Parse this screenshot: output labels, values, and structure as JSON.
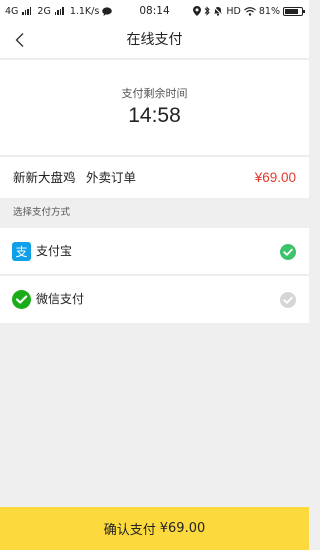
{
  "status_bar": {
    "net1": "4G",
    "net2": "2G",
    "speed": "1.1K/s",
    "time": "08:14",
    "hd": "HD",
    "battery": "81%",
    "battery_level": 0.81
  },
  "header": {
    "title": "在线支付"
  },
  "timer": {
    "label": "支付剩余时间",
    "value": "14:58"
  },
  "order": {
    "shop": "新新大盘鸡",
    "type": "外卖订单",
    "price": "¥69.00"
  },
  "payment": {
    "section_title": "选择支付方式",
    "options": [
      {
        "label": "支付宝",
        "icon": "alipay-icon",
        "selected": true
      },
      {
        "label": "微信支付",
        "icon": "wechat-icon",
        "selected": false
      }
    ]
  },
  "confirm": {
    "label": "确认支付",
    "amount": "¥69.00"
  },
  "colors": {
    "accent": "#fcd93c",
    "price": "#e0392b",
    "check_selected": "#3cc36b",
    "check_unselected": "#d6d6d6",
    "alipay": "#0fa0e8",
    "wechat": "#1aad19"
  }
}
